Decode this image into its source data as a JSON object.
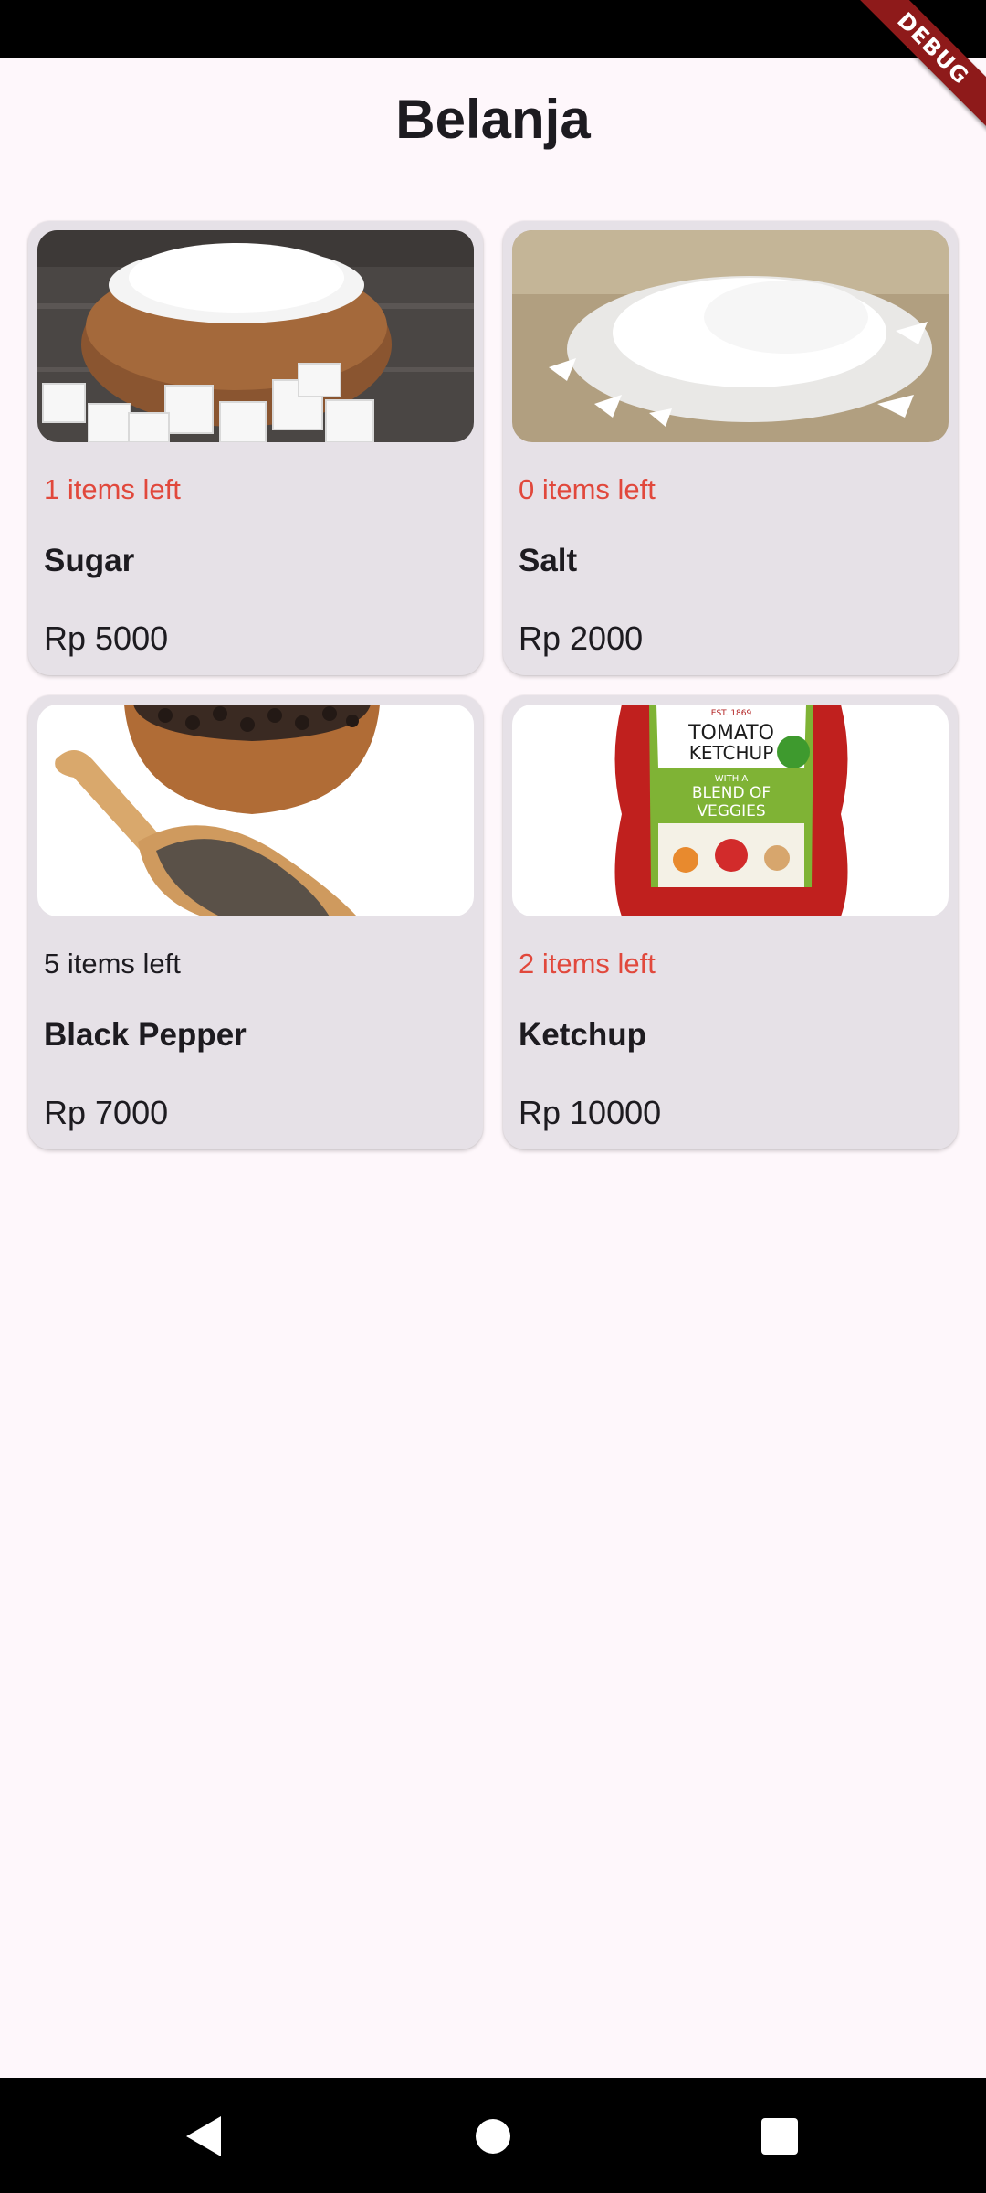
{
  "app": {
    "title": "Belanja",
    "debug_label": "DEBUG"
  },
  "colors": {
    "low_stock": "#e1483c",
    "card_bg": "#e6e1e7",
    "page_bg": "#fef7fb"
  },
  "products": [
    {
      "name": "Sugar",
      "stock_text": "1 items left",
      "price": "Rp 5000",
      "image_icon": "sugar-image"
    },
    {
      "name": "Salt",
      "stock_text": "0 items left",
      "price": "Rp 2000",
      "image_icon": "salt-image"
    },
    {
      "name": "Black Pepper",
      "stock_text": "5 items left",
      "price": "Rp 7000",
      "image_icon": "black-pepper-image"
    },
    {
      "name": "Ketchup",
      "stock_text": "2 items left",
      "price": "Rp 10000",
      "image_icon": "ketchup-image",
      "image_text": {
        "brand": "EST. 1869",
        "line1": "TOMATO",
        "line2": "KETCHUP",
        "line3": "WITH A",
        "line4": "BLEND OF",
        "line5": "VEGGIES"
      }
    }
  ],
  "nav": {
    "back_icon": "back-icon",
    "home_icon": "home-icon",
    "recents_icon": "recents-icon"
  }
}
